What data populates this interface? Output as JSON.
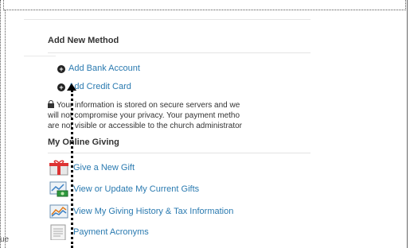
{
  "add_method": {
    "title": "Add New Method",
    "bank_label": "Add Bank Account",
    "card_label": "Add Credit Card",
    "info_lines": [
      "Your information is stored on secure servers and we",
      "will not compromise your privacy. Your payment metho",
      "are not visible or accessible to the church administrator"
    ]
  },
  "online_giving": {
    "title": "My Online Giving",
    "items": [
      {
        "label": "Give a New Gift",
        "icon": "gift-icon"
      },
      {
        "label": "View or Update My Current Gifts",
        "icon": "money-icon"
      },
      {
        "label": "View My Giving History & Tax Information",
        "icon": "chart-icon"
      },
      {
        "label": "Payment Acronyms",
        "icon": "document-icon"
      }
    ]
  },
  "edge_text": "ue",
  "colors": {
    "link": "#2a7ab0",
    "text": "#333333"
  }
}
